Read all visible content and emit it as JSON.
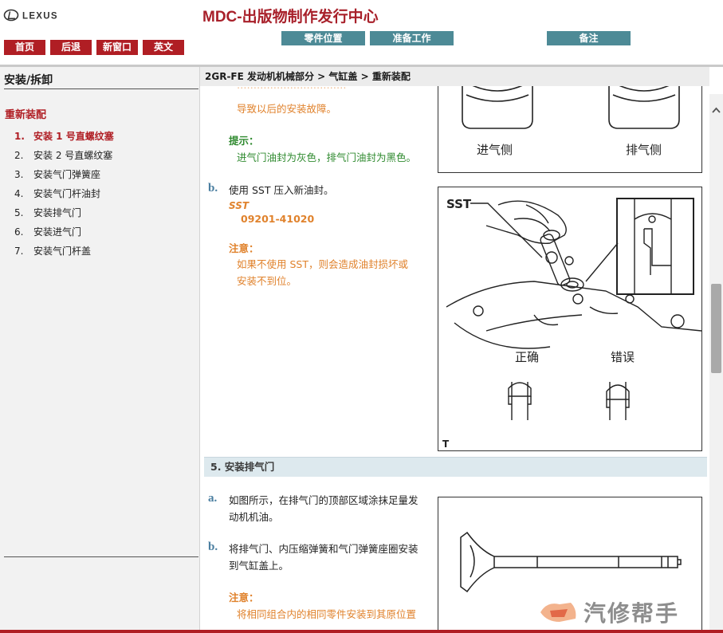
{
  "header": {
    "logo_text": "LEXUS",
    "site_title": "MDC-出版物制作发行中心",
    "nav_buttons": [
      "首页",
      "后退",
      "新窗口",
      "英文"
    ],
    "tool_buttons": [
      "零件位置",
      "准备工作",
      "备注"
    ]
  },
  "sidebar": {
    "heading": "安装/拆卸",
    "section_title": "重新装配",
    "items": [
      {
        "num": "1.",
        "label": "安装 1 号直螺纹塞",
        "active": true
      },
      {
        "num": "2.",
        "label": "安装 2 号直螺纹塞",
        "active": false
      },
      {
        "num": "3.",
        "label": "安装气门弹簧座",
        "active": false
      },
      {
        "num": "4.",
        "label": "安装气门杆油封",
        "active": false
      },
      {
        "num": "5.",
        "label": "安装排气门",
        "active": false
      },
      {
        "num": "6.",
        "label": "安装进气门",
        "active": false
      },
      {
        "num": "7.",
        "label": "安装气门杆盖",
        "active": false
      }
    ]
  },
  "breadcrumb": "2GR-FE 发动机机械部分 > 气缸盖 > 重新装配",
  "content": {
    "prev_note_line": "导致以后的安装故障。",
    "hint_label": "提示：",
    "hint_text": "进气门油封为灰色，排气门油封为黑色。",
    "fig1_labels": {
      "intake": "进气侧",
      "exhaust": "排气侧"
    },
    "step_b": {
      "letter": "b.",
      "text": "使用 SST 压入新油封。",
      "sst_label": "SST",
      "sst_number": "09201-41020",
      "notice_label": "注意：",
      "notice_line1": "如果不使用 SST，则会造成油封损坏或",
      "notice_line2": "安装不到位。"
    },
    "fig2_labels": {
      "sst": "SST",
      "correct": "正确",
      "wrong": "错误",
      "corner": "T"
    },
    "section5_title": "5. 安装排气门",
    "step5a": {
      "letter": "a.",
      "line1": "如图所示，在排气门的顶部区域涂抹足量发",
      "line2": "动机机油。"
    },
    "step5b": {
      "letter": "b.",
      "line1": "将排气门、内压缩弹簧和气门弹簧座圈安装",
      "line2": "到气缸盖上。"
    },
    "notice2_label": "注意：",
    "notice2_text": "将相同组合内的相同零件安装到其原位置"
  },
  "watermark_text": "汽修帮手",
  "colors": {
    "brand_red": "#b01e24",
    "tool_teal": "#4d8a96",
    "orange": "#e0822c",
    "green": "#2f8a2f",
    "step_blue": "#4a7ea0"
  }
}
